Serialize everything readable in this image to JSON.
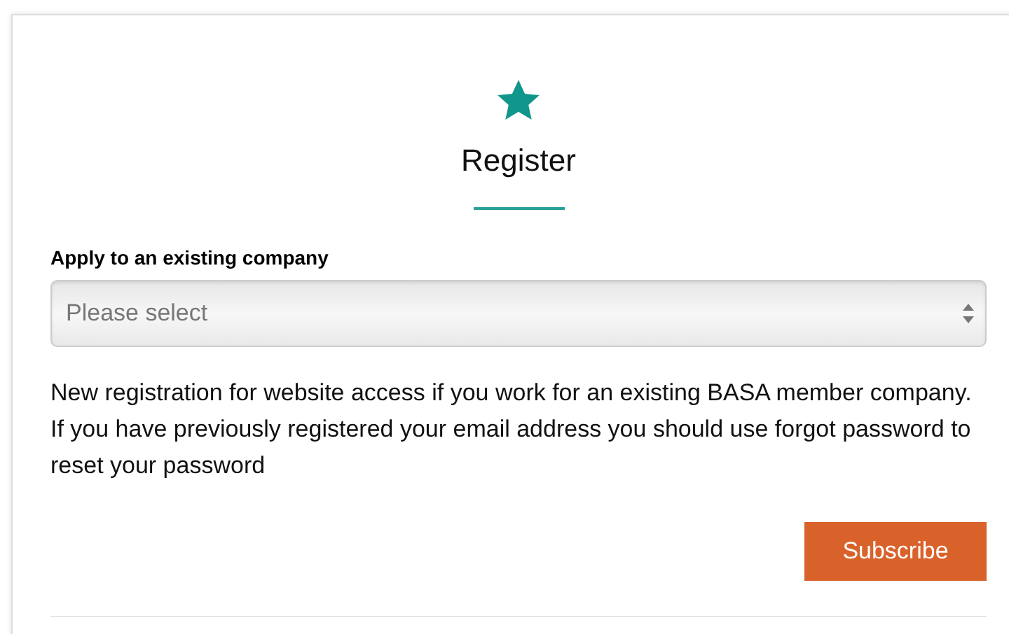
{
  "heading": "Register",
  "field": {
    "label": "Apply to an existing company",
    "placeholder": "Please select"
  },
  "description": "New registration for website access if you work for an existing BASA member company. If you have previously registered your email address you should use forgot password to reset your password",
  "buttons": [
    "Subscribe"
  ]
}
